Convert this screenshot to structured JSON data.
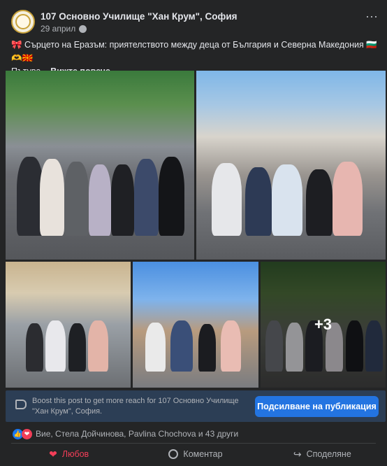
{
  "post": {
    "page_name": "107 Основно Училище \"Хан Крум\", София",
    "date": "29 април",
    "more_icon": "⋯",
    "text_line1": "🎀 Сърцето на Еразъм: приятелството между деца от България и Северна Македония 🇧🇬🫶🇲🇰",
    "text_line2": "Пътува...",
    "see_more": "Вижте повече"
  },
  "photos": {
    "more_count": "+3"
  },
  "boost": {
    "text": "Boost this post to get more reach for 107 Основно Училище \"Хан Крум\", София.",
    "button_label": "Подсилване на публикация"
  },
  "reactions": {
    "like_icon": "👍",
    "love_icon": "❤",
    "summary": "Вие, Стела Дойчинова, Pavlina Chochova и 43 други"
  },
  "actions": {
    "love_label": "Любов",
    "comment_label": "Коментар",
    "share_label": "Споделяне"
  },
  "colors": {
    "background": "#242526",
    "boost_bg": "#2c3e55",
    "primary_button": "#2374e1",
    "love_red": "#f33e58",
    "like_blue": "#1877f2"
  }
}
